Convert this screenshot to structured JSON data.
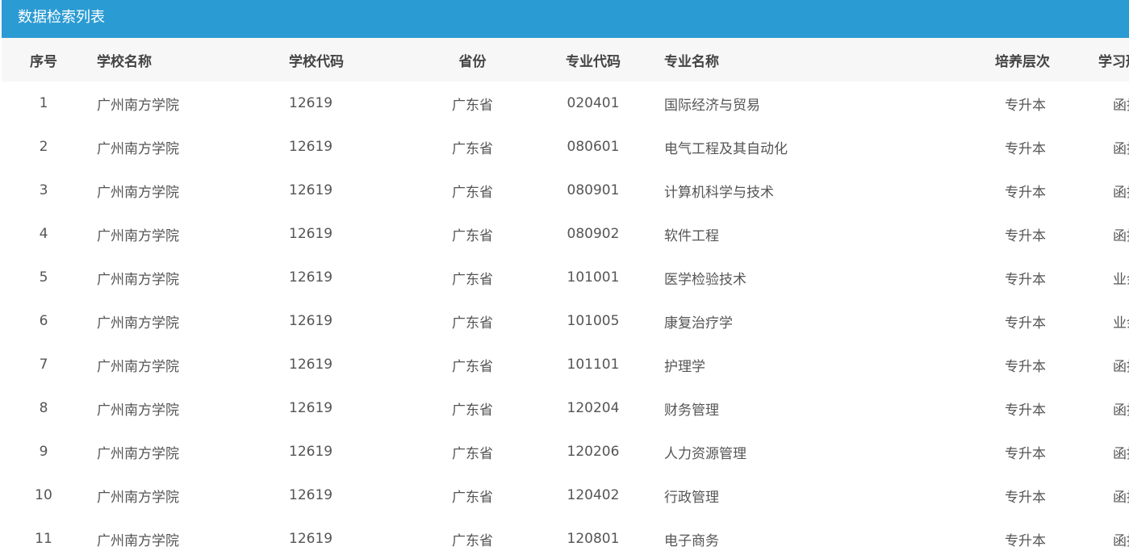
{
  "panel": {
    "title": "数据检索列表"
  },
  "table": {
    "headers": {
      "index": "序号",
      "school_name": "学校名称",
      "school_code": "学校代码",
      "province": "省份",
      "major_code": "专业代码",
      "major_name": "专业名称",
      "level": "培养层次",
      "study_form": "学习形式"
    },
    "rows": [
      {
        "index": "1",
        "school_name": "广州南方学院",
        "school_code": "12619",
        "province": "广东省",
        "major_code": "020401",
        "major_name": "国际经济与贸易",
        "level": "专升本",
        "study_form": "函授"
      },
      {
        "index": "2",
        "school_name": "广州南方学院",
        "school_code": "12619",
        "province": "广东省",
        "major_code": "080601",
        "major_name": "电气工程及其自动化",
        "level": "专升本",
        "study_form": "函授"
      },
      {
        "index": "3",
        "school_name": "广州南方学院",
        "school_code": "12619",
        "province": "广东省",
        "major_code": "080901",
        "major_name": "计算机科学与技术",
        "level": "专升本",
        "study_form": "函授"
      },
      {
        "index": "4",
        "school_name": "广州南方学院",
        "school_code": "12619",
        "province": "广东省",
        "major_code": "080902",
        "major_name": "软件工程",
        "level": "专升本",
        "study_form": "函授"
      },
      {
        "index": "5",
        "school_name": "广州南方学院",
        "school_code": "12619",
        "province": "广东省",
        "major_code": "101001",
        "major_name": "医学检验技术",
        "level": "专升本",
        "study_form": "业余"
      },
      {
        "index": "6",
        "school_name": "广州南方学院",
        "school_code": "12619",
        "province": "广东省",
        "major_code": "101005",
        "major_name": "康复治疗学",
        "level": "专升本",
        "study_form": "业余"
      },
      {
        "index": "7",
        "school_name": "广州南方学院",
        "school_code": "12619",
        "province": "广东省",
        "major_code": "101101",
        "major_name": "护理学",
        "level": "专升本",
        "study_form": "函授"
      },
      {
        "index": "8",
        "school_name": "广州南方学院",
        "school_code": "12619",
        "province": "广东省",
        "major_code": "120204",
        "major_name": "财务管理",
        "level": "专升本",
        "study_form": "函授"
      },
      {
        "index": "9",
        "school_name": "广州南方学院",
        "school_code": "12619",
        "province": "广东省",
        "major_code": "120206",
        "major_name": "人力资源管理",
        "level": "专升本",
        "study_form": "函授"
      },
      {
        "index": "10",
        "school_name": "广州南方学院",
        "school_code": "12619",
        "province": "广东省",
        "major_code": "120402",
        "major_name": "行政管理",
        "level": "专升本",
        "study_form": "函授"
      },
      {
        "index": "11",
        "school_name": "广州南方学院",
        "school_code": "12619",
        "province": "广东省",
        "major_code": "120801",
        "major_name": "电子商务",
        "level": "专升本",
        "study_form": "函授"
      }
    ]
  },
  "colors": {
    "header_bar": "#2b9bd3",
    "table_head_bg": "#f7f7f7"
  }
}
